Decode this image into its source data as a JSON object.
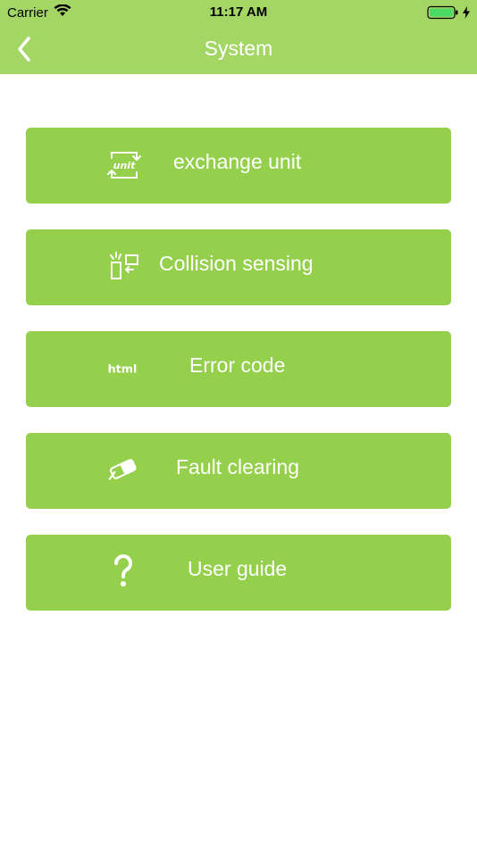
{
  "status_bar": {
    "carrier": "Carrier",
    "time": "11:17 AM"
  },
  "nav": {
    "title": "System",
    "back_icon": "chevron-left-icon"
  },
  "menu": {
    "items": [
      {
        "label": "exchange unit",
        "icon": "unit-exchange-icon"
      },
      {
        "label": "Collision sensing",
        "icon": "collision-icon"
      },
      {
        "label": "Error code",
        "icon": "html-icon"
      },
      {
        "label": "Fault clearing",
        "icon": "eraser-icon"
      },
      {
        "label": "User guide",
        "icon": "question-icon"
      }
    ]
  },
  "colors": {
    "bar": "#a3d665",
    "button": "#94d04b",
    "text": "#ffffff"
  }
}
